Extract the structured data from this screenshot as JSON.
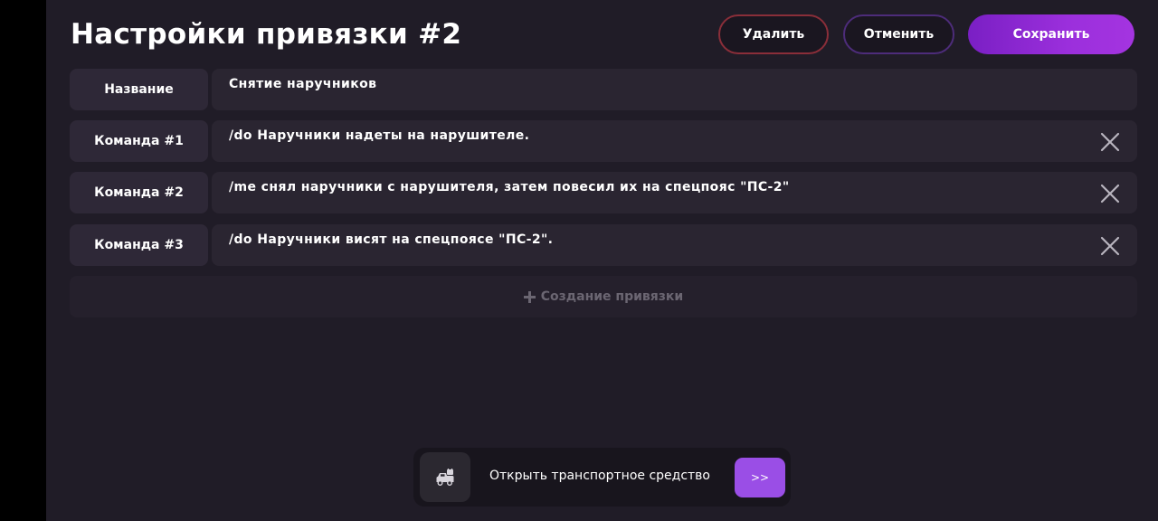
{
  "header": {
    "title": "Настройки привязки #2",
    "delete_label": "Удалить",
    "cancel_label": "Отменить",
    "save_label": "Сохранить"
  },
  "rows": [
    {
      "label": "Название",
      "value": "Снятие наручников",
      "removable": false
    },
    {
      "label": "Команда #1",
      "value": "/do Наручники надеты на нарушителе.",
      "removable": true
    },
    {
      "label": "Команда #2",
      "value": "/me снял наручники с нарушителя, затем повесил их на спецпояс \"ПС-2\"",
      "removable": true
    },
    {
      "label": "Команда #3",
      "value": "/do Наручники висят на спецпоясе \"ПС-2\".",
      "removable": true
    }
  ],
  "create_binding": {
    "label": "Создание привязки",
    "icon": "plus-icon"
  },
  "toast": {
    "icon": "car-lock-icon",
    "text": "Открыть транспортное средство",
    "action_label": ">>"
  },
  "colors": {
    "background": "#201c27",
    "accent": "#9b2fdc",
    "danger_border": "#8a2e39"
  }
}
